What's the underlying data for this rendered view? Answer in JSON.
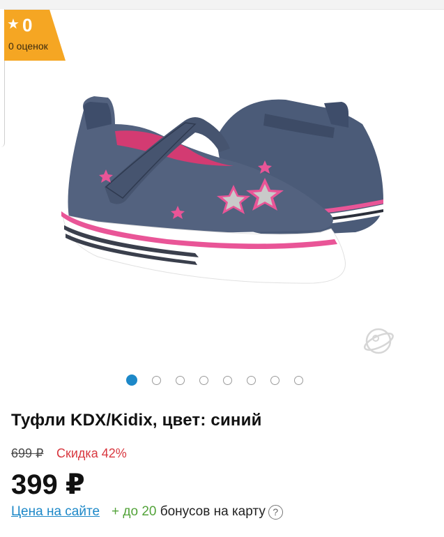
{
  "rating": {
    "star_glyph": "★",
    "value": "0",
    "count_label": "0 оценок",
    "color": "#f5a623"
  },
  "gallery": {
    "image_name": "shoe-image",
    "watermark_icon": "planet-logo-icon",
    "dots_count": 8,
    "active_index": 0,
    "active_color": "#1d88c8"
  },
  "product": {
    "title": "Туфли KDX/Kidix, цвет: синий",
    "old_price": "699 ₽",
    "discount": "Скидка 42%",
    "price": "399 ₽"
  },
  "footer": {
    "price_link": "Цена на сайте",
    "bonus_plus": "+ до",
    "bonus_number": "20",
    "bonus_text": "бонусов на карту",
    "help_glyph": "?"
  }
}
